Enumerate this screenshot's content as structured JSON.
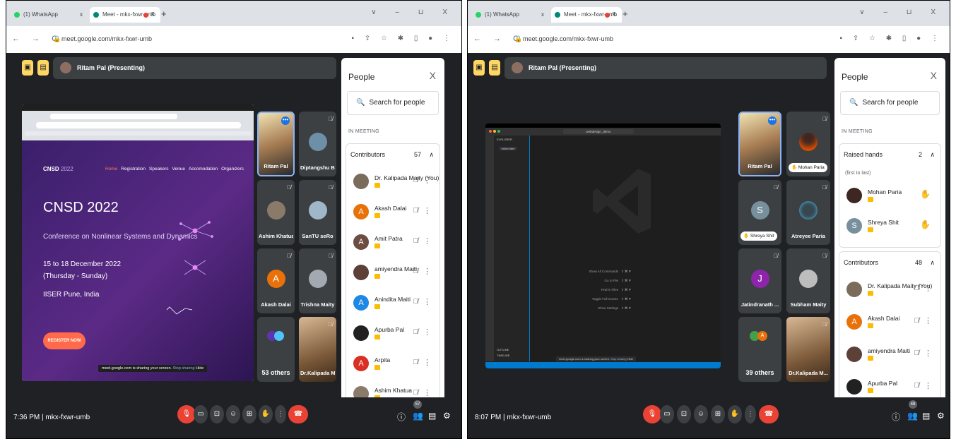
{
  "screens": [
    {
      "browser": {
        "tabs": [
          "(1) WhatsApp",
          "Meet - mkx-fxwr-umb"
        ],
        "url": "meet.google.com/mkx-fxwr-umb",
        "window_controls": "∨ – ⊔ X"
      },
      "presenter": "Ritam Pal (Presenting)",
      "shared": {
        "logo": "CNSD",
        "logo_year": "2022",
        "nav": [
          "Home",
          "Registration",
          "Speakers",
          "Venue",
          "Accomodation",
          "Organizers"
        ],
        "title": "CNSD 2022",
        "subtitle": "Conference on Nonlinear Systems and Dynamics",
        "dates": "15 to 18 December 2022",
        "days": "(Thursday - Sunday)",
        "venue": "IISER Pune, India",
        "cta": "REGISTER NOW",
        "banner": "meet.google.com is sharing your screen.",
        "banner_stop": "Stop sharing",
        "banner_hide": "Hide"
      },
      "tiles": [
        {
          "name": "Ritam Pal",
          "kind": "camera"
        },
        {
          "name": "Diptangshu B...",
          "kind": "photo",
          "color": "#6d8fa8"
        },
        {
          "name": "Ashim Khatua",
          "kind": "photo",
          "color": "#8a7a6a"
        },
        {
          "name": "SanTU seRo",
          "kind": "photo",
          "color": "#9fb7c9"
        },
        {
          "name": "Akash Dalai",
          "kind": "letter",
          "letter": "A",
          "color": "#e8710a"
        },
        {
          "name": "Trishna Maity",
          "kind": "photo",
          "color": "#a2a9b0"
        },
        {
          "name": "53 others",
          "kind": "others"
        },
        {
          "name": "Dr.Kalipada M...",
          "kind": "camera2"
        }
      ],
      "people": {
        "title": "People",
        "search": "Search for people",
        "section": "IN MEETING",
        "groups": [
          {
            "label": "Contributors",
            "count": "57",
            "members": [
              {
                "name": "Dr. Kalipada Maity (You)",
                "av": "photo",
                "color": "#7b6b5a"
              },
              {
                "name": "Akash Dalai",
                "av": "A",
                "color": "#e8710a"
              },
              {
                "name": "Amit Patra",
                "av": "A",
                "color": "#6d4c41"
              },
              {
                "name": "amiyendra Maiti",
                "av": "photo",
                "color": "#5d4037"
              },
              {
                "name": "Anindita Maiti",
                "av": "A",
                "color": "#1e88e5"
              },
              {
                "name": "Apurba Pal",
                "av": "photo",
                "color": "#212121"
              },
              {
                "name": "Arpita",
                "av": "A",
                "color": "#d93025"
              },
              {
                "name": "Ashim Khatua",
                "av": "photo",
                "color": "#8a7a6a"
              }
            ]
          }
        ]
      },
      "bottom": {
        "time": "7:36 PM",
        "sep": "|",
        "code": "mkx-fxwr-umb",
        "badge": "57"
      }
    },
    {
      "browser": {
        "tabs": [
          "(1) WhatsApp",
          "Meet - mkx-fxwr-umb"
        ],
        "url": "meet.google.com/mkx-fxwr-umb",
        "window_controls": "∨ – ⊔ X"
      },
      "presenter": "Ritam Pal (Presenting)",
      "shared": {
        "search_box": "webdesign_demo",
        "explorer": "EXPLORER",
        "file": "index.html",
        "shortcuts": [
          "Show All Commands",
          "Go to File",
          "Find in Files",
          "Toggle Full Screen",
          "Show Settings"
        ],
        "outline": "OUTLINE",
        "timeline": "TIMELINE",
        "banner": "meet.google.com is sharing your screen.",
        "banner_stop": "Stop sharing",
        "banner_hide": "Hide"
      },
      "tiles": [
        {
          "name": "Ritam Pal",
          "kind": "camera"
        },
        {
          "name": "Mohan Paria",
          "kind": "chip",
          "color": "#3e2723"
        },
        {
          "name": "Shreya Shit",
          "kind": "chip-letter",
          "letter": "S",
          "color": "#78909c"
        },
        {
          "name": "Atreyee Paria",
          "kind": "photo",
          "color": "#37474f"
        },
        {
          "name": "Jatindranath ...",
          "kind": "letter",
          "letter": "J",
          "color": "#8e24aa"
        },
        {
          "name": "Subham Maity",
          "kind": "photo",
          "color": "#bdbdbd"
        },
        {
          "name": "39 others",
          "kind": "others"
        },
        {
          "name": "Dr.Kalipada M...",
          "kind": "camera2"
        }
      ],
      "people": {
        "title": "People",
        "search": "Search for people",
        "section": "IN MEETING",
        "groups": [
          {
            "label": "Raised hands",
            "count": "2",
            "sub": "(first to last)",
            "members": [
              {
                "name": "Mohan Paria",
                "av": "photo",
                "color": "#3e2723",
                "hand": true
              },
              {
                "name": "Shreya Shit",
                "av": "S",
                "color": "#78909c",
                "hand": true
              }
            ]
          },
          {
            "label": "Contributors",
            "count": "48",
            "members": [
              {
                "name": "Dr. Kalipada Maity (You)",
                "av": "photo",
                "color": "#7b6b5a"
              },
              {
                "name": "Akash Dalai",
                "av": "A",
                "color": "#e8710a"
              },
              {
                "name": "amiyendra Maiti",
                "av": "photo",
                "color": "#5d4037"
              },
              {
                "name": "Apurba Pal",
                "av": "photo",
                "color": "#212121"
              }
            ]
          }
        ]
      },
      "bottom": {
        "time": "8:07 PM",
        "sep": "|",
        "code": "mkx-fxwr-umb",
        "badge": "48"
      }
    }
  ]
}
